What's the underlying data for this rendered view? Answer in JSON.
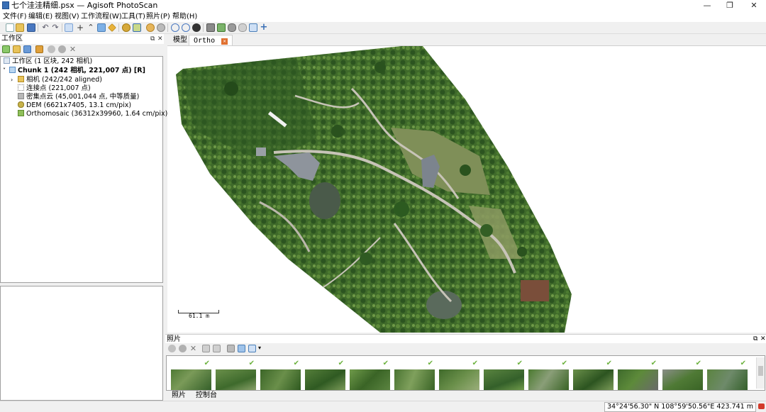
{
  "window": {
    "title": "七个洼洼精细.psx — Agisoft PhotoScan",
    "minimize": "—",
    "restore": "❐",
    "close": "✕"
  },
  "menu": [
    "文件(F)",
    "编辑(E)",
    "视图(V)",
    "工作流程(W)",
    "工具(T)",
    "照片(P)",
    "帮助(H)"
  ],
  "workspace": {
    "title": "工作区",
    "float": "⧉",
    "close": "✕",
    "tree": {
      "root": "工作区 (1 区块, 242 相机)",
      "chunk": "Chunk 1 (242 相机, 221,007 点) [R]",
      "cameras": "相机 (242/242 aligned)",
      "tie_points": "连接点 (221,007 点)",
      "dense_cloud": "密集点云 (45,001,044 点, 中等质量)",
      "dem": "DEM (6621x7405, 13.1 cm/pix)",
      "ortho": "Orthomosaic (36312x39960, 1.64 cm/pix)"
    }
  },
  "view": {
    "tab_model": "模型",
    "tab_ortho": "Ortho",
    "scale_bar": "61.1 m"
  },
  "photos": {
    "title": "照片",
    "float": "⧉",
    "close": "✕",
    "check": "✔",
    "tab_photos": "照片",
    "tab_console": "控制台"
  },
  "status": {
    "coords": "34°24'56.30\" N  108°59'50.56\"E 423.741 m"
  },
  "colors": {
    "accent": "#3a6fb5",
    "check": "#6db33f",
    "vegetation": "#3f6a2a"
  }
}
